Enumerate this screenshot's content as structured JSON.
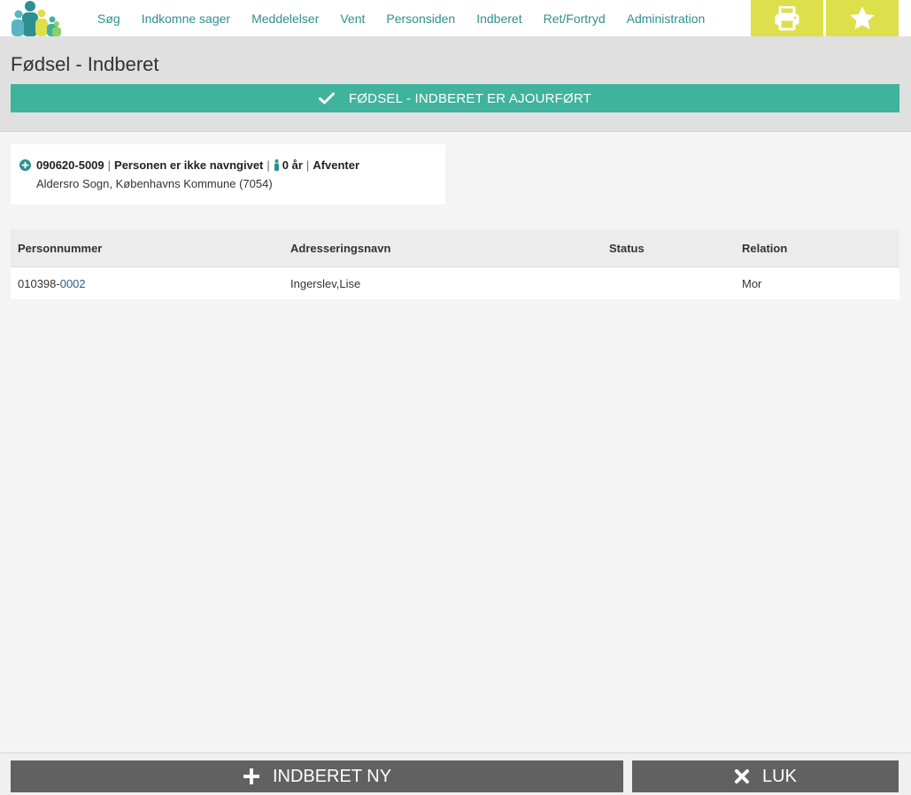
{
  "nav": {
    "items": [
      "Søg",
      "Indkomne sager",
      "Meddelelser",
      "Vent",
      "Personsiden",
      "Indberet",
      "Ret/Fortryd",
      "Administration"
    ]
  },
  "tools": {
    "print_icon": "printer-icon",
    "favorite_icon": "star-icon"
  },
  "header": {
    "title": "Fødsel - Indberet",
    "banner": "FØDSEL - INDBERET ER AJOURFØRT"
  },
  "person": {
    "cpr": "090620-5009",
    "name_status": "Personen er ikke navngivet",
    "age": "0 år",
    "state": "Afventer",
    "address": "Aldersro Sogn, Københavns Kommune (7054)"
  },
  "table": {
    "headers": [
      "Personnummer",
      "Adresseringsnavn",
      "Status",
      "Relation"
    ],
    "rows": [
      {
        "cpr_prefix": "010398-",
        "cpr_suffix": "0002",
        "name": "Ingerslev,Lise",
        "status": "",
        "relation": "Mor"
      }
    ]
  },
  "footer": {
    "new_label": "INDBERET NY",
    "close_label": "LUK"
  },
  "colors": {
    "accent": "#2e8f91",
    "success": "#3fb39c",
    "tool": "#dde04a",
    "footer_button": "#616161"
  }
}
